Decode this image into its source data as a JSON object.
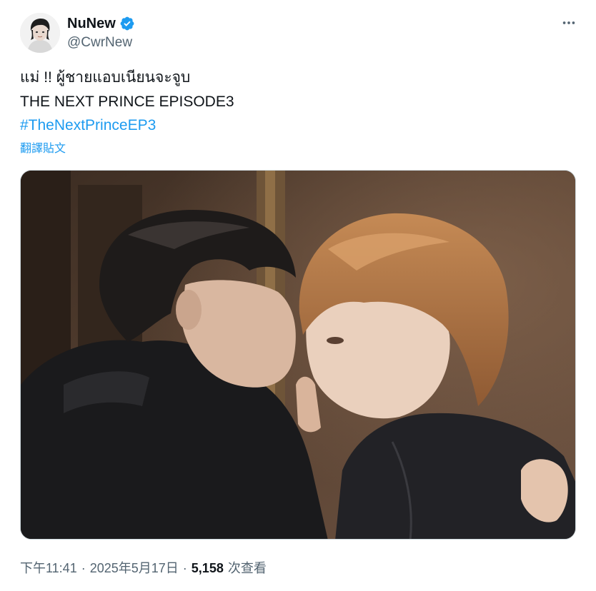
{
  "author": {
    "display_name": "NuNew",
    "handle": "@CwrNew",
    "verified_color": "#1d9bf0"
  },
  "tweet": {
    "line1": "แม่ !! ผู้ชายแอบเนียนจะจูบ",
    "line2": "THE NEXT PRINCE EPISODE3",
    "hashtag": "#TheNextPrinceEP3",
    "translate_label": "翻譯貼文"
  },
  "meta": {
    "time": "下午11:41",
    "separator": "·",
    "date": "2025年5月17日",
    "views_count": "5,158",
    "views_label": "次查看"
  },
  "colors": {
    "text": "#0f1419",
    "secondary": "#536471",
    "link": "#1d9bf0"
  },
  "icons": {
    "verified": "verified-badge-icon",
    "more": "more-horizontal-icon"
  }
}
